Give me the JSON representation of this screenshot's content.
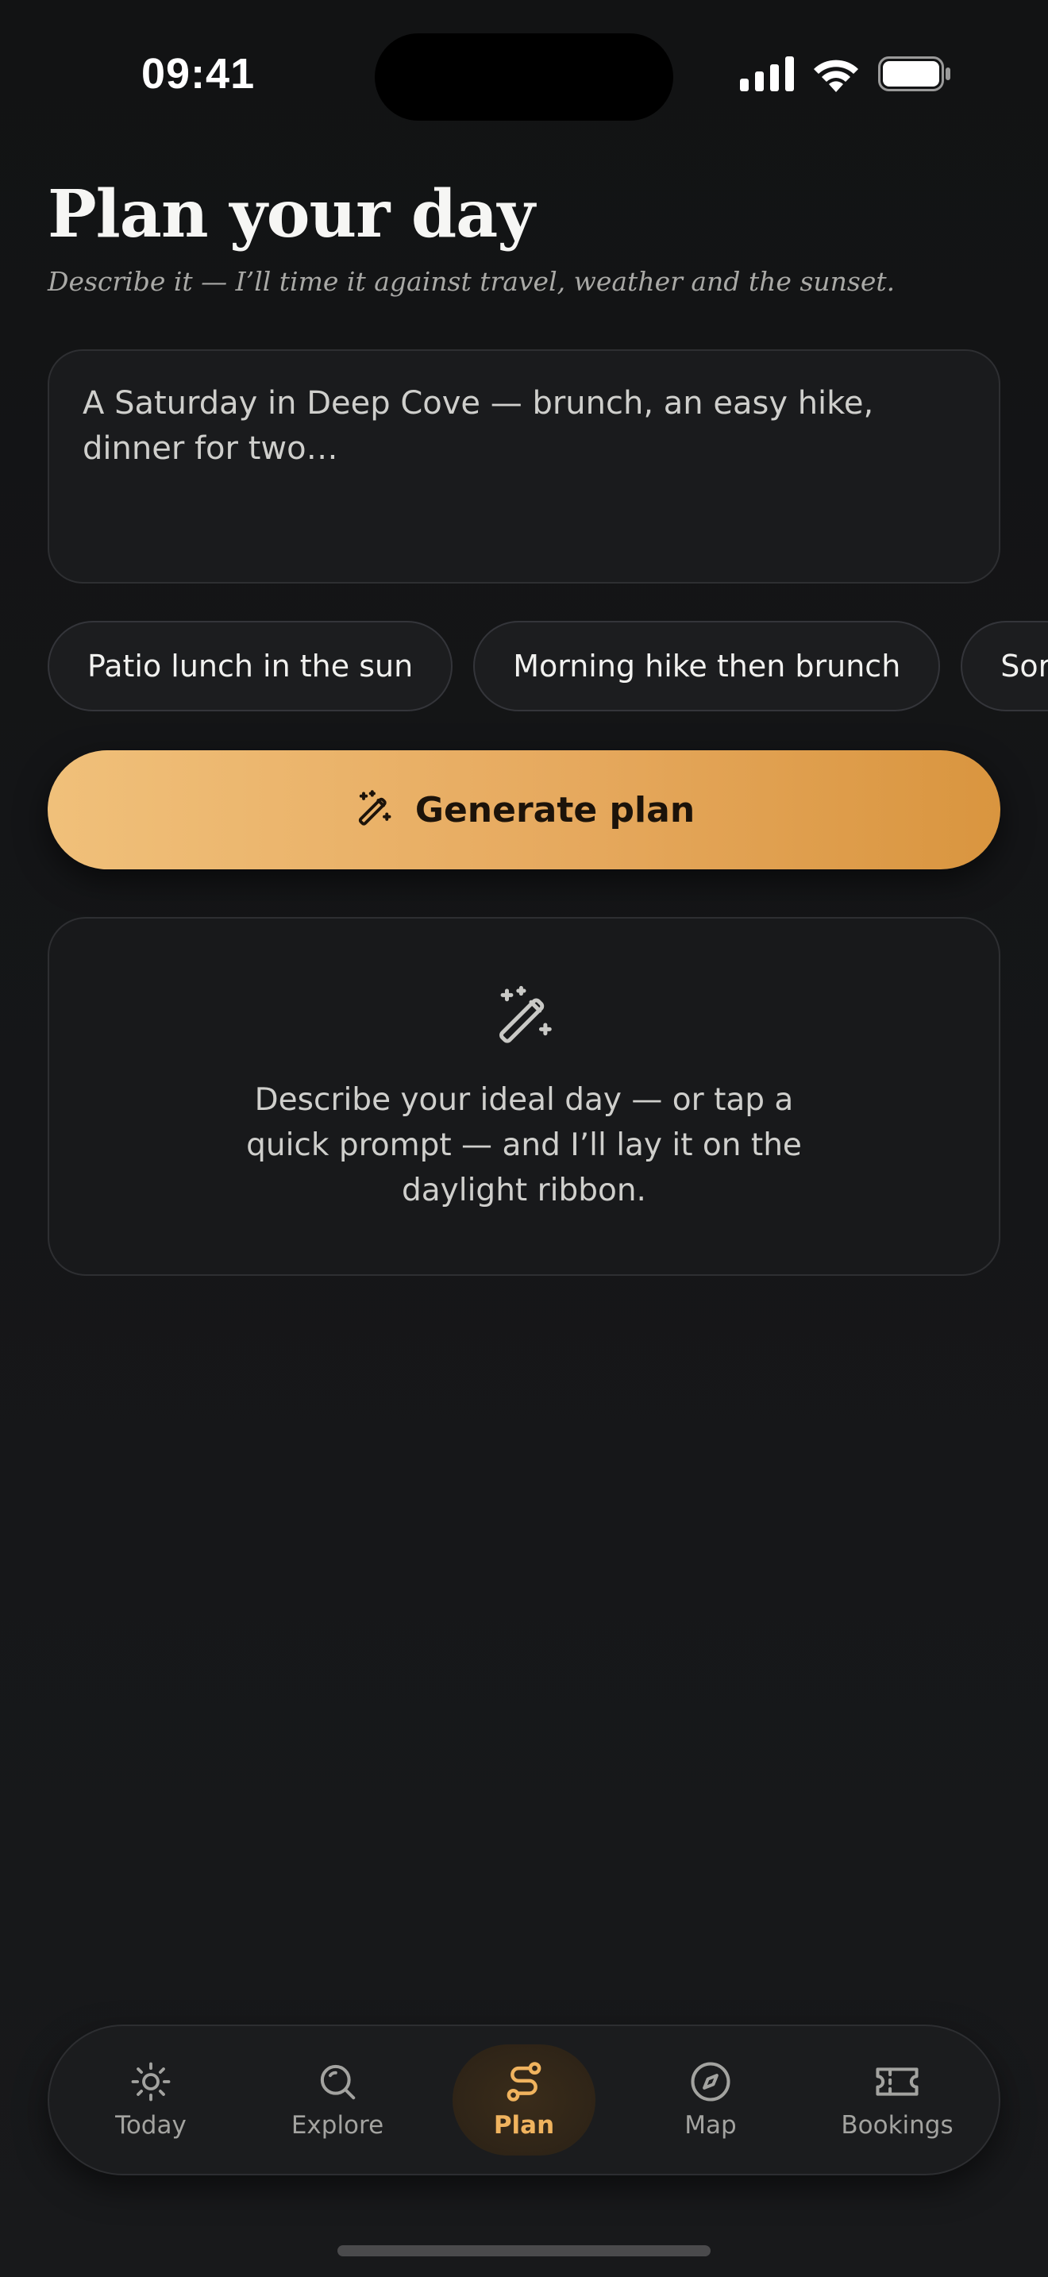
{
  "status": {
    "time": "09:41"
  },
  "header": {
    "title": "Plan your day",
    "subtitle": "Describe it — I’ll time it against travel, weather and the sunset."
  },
  "prompt": {
    "placeholder": "A Saturday in Deep Cove — brunch, an easy hike, dinner for two…"
  },
  "quick_prompts": [
    {
      "label": "Patio lunch in the sun"
    },
    {
      "label": "Morning hike then brunch"
    },
    {
      "label": "Sor"
    }
  ],
  "generate": {
    "label": "Generate plan",
    "icon": "magic-wand-icon"
  },
  "empty_state": {
    "icon": "magic-wand-icon",
    "message": "Describe your ideal day — or tap a quick prompt — and I’ll lay it on the daylight ribbon."
  },
  "tabs": [
    {
      "label": "Today",
      "icon": "sun-icon"
    },
    {
      "label": "Explore",
      "icon": "search-icon"
    },
    {
      "label": "Plan",
      "icon": "route-icon",
      "active": true
    },
    {
      "label": "Map",
      "icon": "compass-icon"
    },
    {
      "label": "Bookings",
      "icon": "ticket-icon"
    }
  ],
  "colors": {
    "accent": "#f0b35e",
    "background": "#141517"
  }
}
